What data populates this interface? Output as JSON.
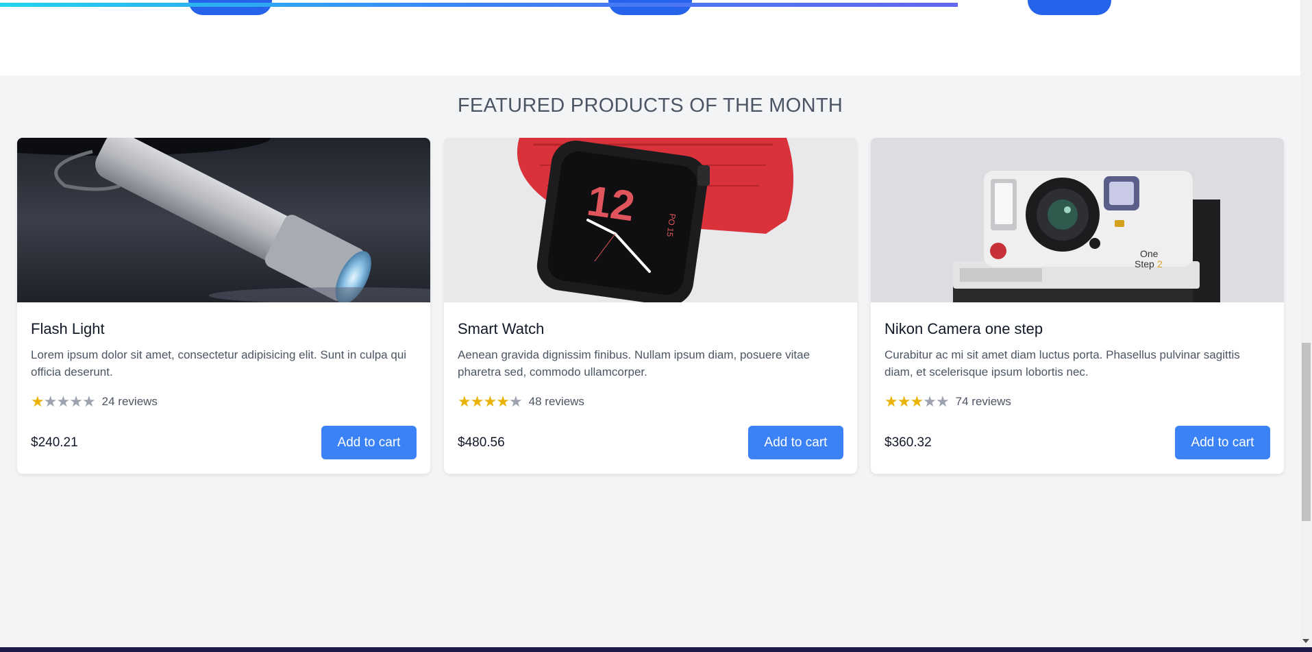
{
  "section_title": "FEATURED PRODUCTS OF THE MONTH",
  "products": [
    {
      "name": "Flash Light",
      "description": "Lorem ipsum dolor sit amet, consectetur adipisicing elit. Sunt in culpa qui officia deserunt.",
      "rating": 1,
      "max_rating": 5,
      "reviews": "24 reviews",
      "price": "$240.21",
      "button_label": "Add to cart"
    },
    {
      "name": "Smart Watch",
      "description": "Aenean gravida dignissim finibus. Nullam ipsum diam, posuere vitae pharetra sed, commodo ullamcorper.",
      "rating": 4,
      "max_rating": 5,
      "reviews": "48 reviews",
      "price": "$480.56",
      "button_label": "Add to cart"
    },
    {
      "name": "Nikon Camera one step",
      "description": "Curabitur ac mi sit amet diam luctus porta. Phasellus pulvinar sagittis diam, et scelerisque ipsum lobortis nec.",
      "rating": 3,
      "max_rating": 5,
      "reviews": "74 reviews",
      "price": "$360.32",
      "button_label": "Add to cart"
    }
  ],
  "watch_face_text": {
    "numeral": "12",
    "date": "PO 15"
  },
  "camera_text": {
    "line1": "One",
    "line2": "Step",
    "suffix": "2"
  },
  "colors": {
    "accent": "#3b82f6",
    "star_active": "#eab308",
    "star_inactive": "#9ca3af",
    "page_background": "#f3f4f6",
    "footer": "#1e1b4b"
  },
  "icons": {
    "star": "star-icon"
  },
  "scroll_progress": 0.73
}
